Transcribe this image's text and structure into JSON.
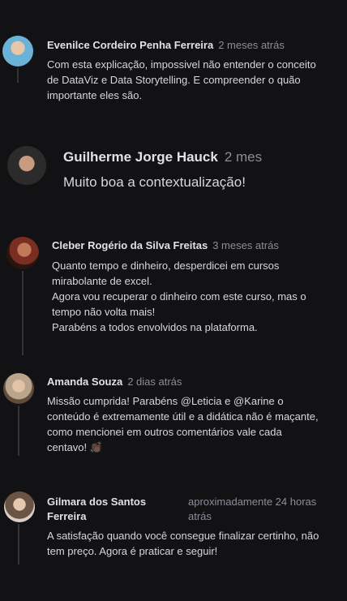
{
  "comments": [
    {
      "author": "Evenilce Cordeiro Penha Ferreira",
      "time": "2 meses atrás",
      "text": "Com esta explicação, impossivel não entender o conceito\nde DataViz e Data Storytelling. E compreender o quão\nimportante eles são.",
      "avatar_colors": [
        "#6bb3d6",
        "#3a6e8f"
      ]
    },
    {
      "author": "Guilherme Jorge Hauck",
      "time": "2 mes",
      "text": "Muito boa a contextualização!",
      "avatar_colors": [
        "#4a4a4a",
        "#1b1b1b"
      ]
    },
    {
      "author": "Cleber Rogério da Silva Freitas",
      "time": "3 meses atrás",
      "text": "Quanto tempo e dinheiro, desperdicei em cursos\nmirabolante de excel.\nAgora vou recuperar o dinheiro com este curso, mas o\ntempo não volta mais!\nParabéns a todos envolvidos na plataforma.",
      "avatar_colors": [
        "#7a2e22",
        "#2a1410"
      ]
    },
    {
      "author": "Amanda Souza",
      "time": "2 dias atrás",
      "text": "Missão cumprida! Parabéns @Leticia e @Karine o\nconteúdo é extremamente útil e a didática não é maçante,\ncomo mencionei em outros comentários vale cada\ncentavo! 👏🏿",
      "avatar_colors": [
        "#b9a58b",
        "#5d4c3b"
      ]
    },
    {
      "author_line1": "Gilmara dos Santos",
      "author_line2": "Ferreira",
      "time_line1": "aproximadamente 24 horas",
      "time_line2": "atrás",
      "text": "A satisfação quando você consegue finalizar certinho, não\ntem preço. Agora é praticar e seguir!",
      "avatar_colors": [
        "#d8cfc6",
        "#5b4a3f"
      ]
    }
  ]
}
